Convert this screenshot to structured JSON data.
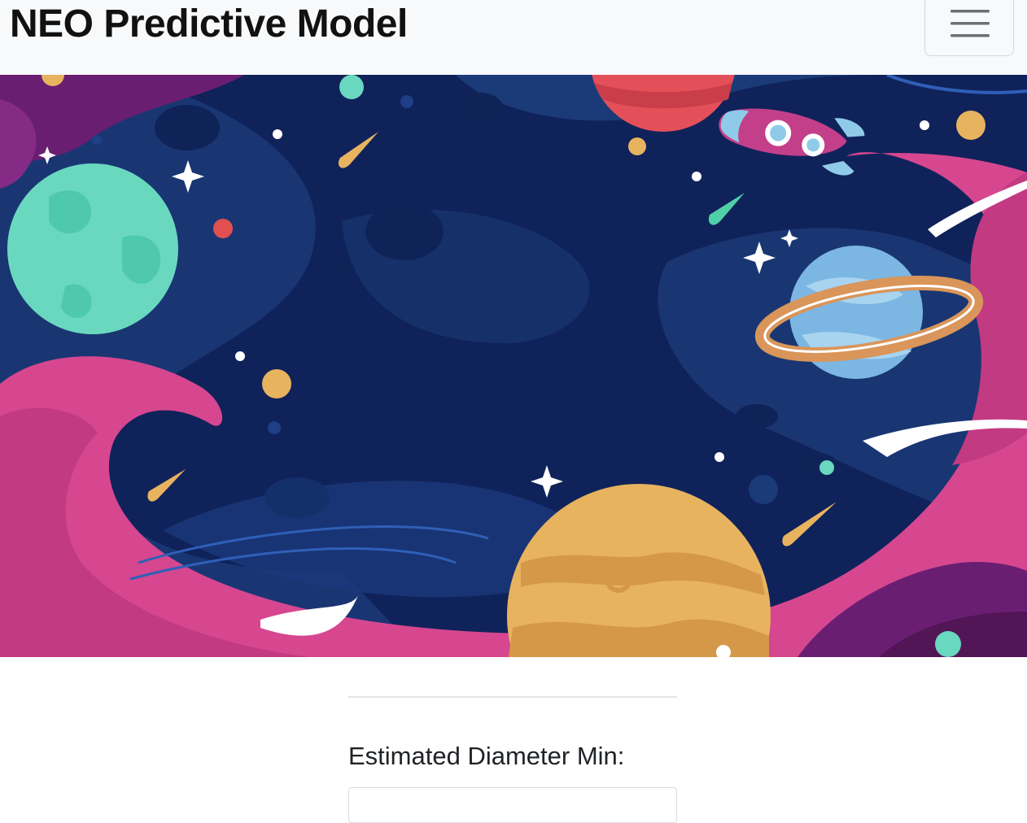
{
  "navbar": {
    "brand": "NEO Predictive Model",
    "toggler_icon": "hamburger-menu-icon"
  },
  "hero": {
    "image": "space-illustration"
  },
  "form": {
    "fields": [
      {
        "label": "Estimated Diameter Min:",
        "value": "",
        "placeholder": ""
      }
    ]
  }
}
